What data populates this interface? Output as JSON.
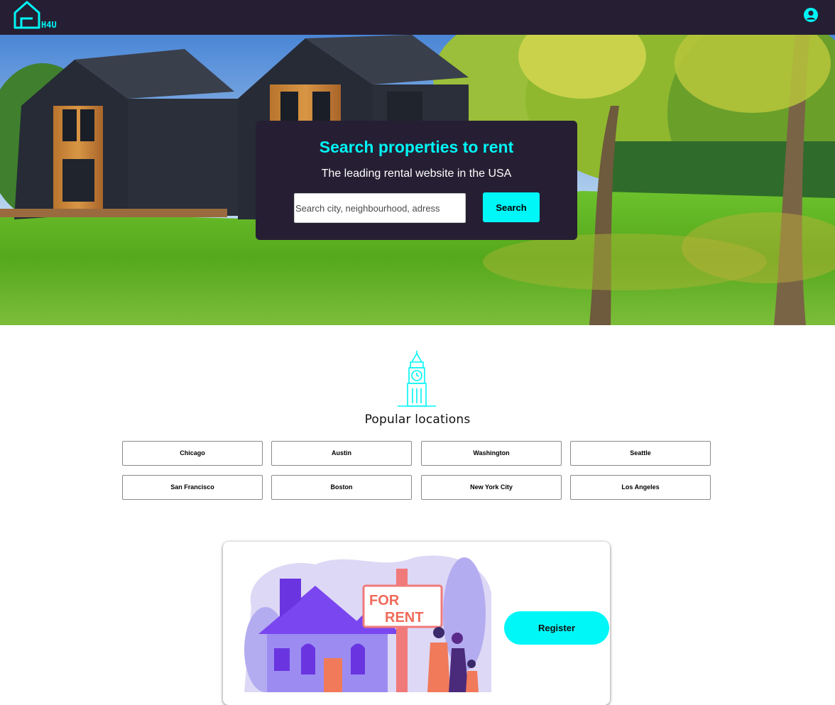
{
  "brand": {
    "logo_text": "H4U",
    "accent_color": "#00f5f5",
    "nav_color": "#261f33"
  },
  "nav": {
    "account_icon": "user-circle-icon"
  },
  "hero": {
    "title": "Search properties to rent",
    "subtitle": "The leading rental website in the USA",
    "search_placeholder": "Search city, neighbourhood, adress",
    "search_button": "Search"
  },
  "popular": {
    "icon": "clock-tower-icon",
    "title": "Popular locations",
    "locations": [
      "Chicago",
      "Austin",
      "Washington",
      "Seattle",
      "San Francisco",
      "Boston",
      "New York City",
      "Los Angeles"
    ]
  },
  "promo": {
    "sign_line1": "FOR",
    "sign_line2": "RENT",
    "register_button": "Register"
  }
}
